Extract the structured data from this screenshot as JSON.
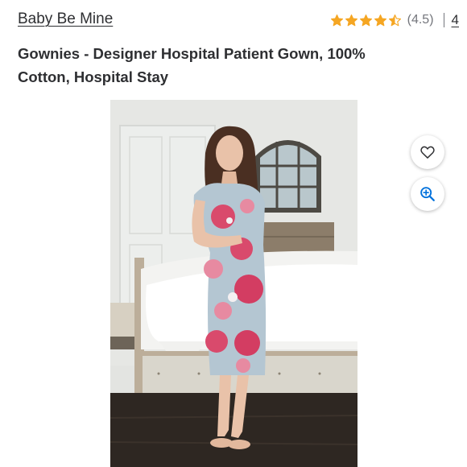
{
  "brand": {
    "name": "Baby Be Mine"
  },
  "rating": {
    "value": 4.5,
    "value_text": "(4.5)",
    "review_count": "4",
    "star_color": "#f5a623"
  },
  "product": {
    "title": "Gownies - Designer Hospital Patient Gown, 100% Cotton, Hospital Stay"
  },
  "actions": {
    "favorite_icon": "heart-icon",
    "zoom_icon": "zoom-in-icon",
    "accent_color": "#0071dc"
  }
}
